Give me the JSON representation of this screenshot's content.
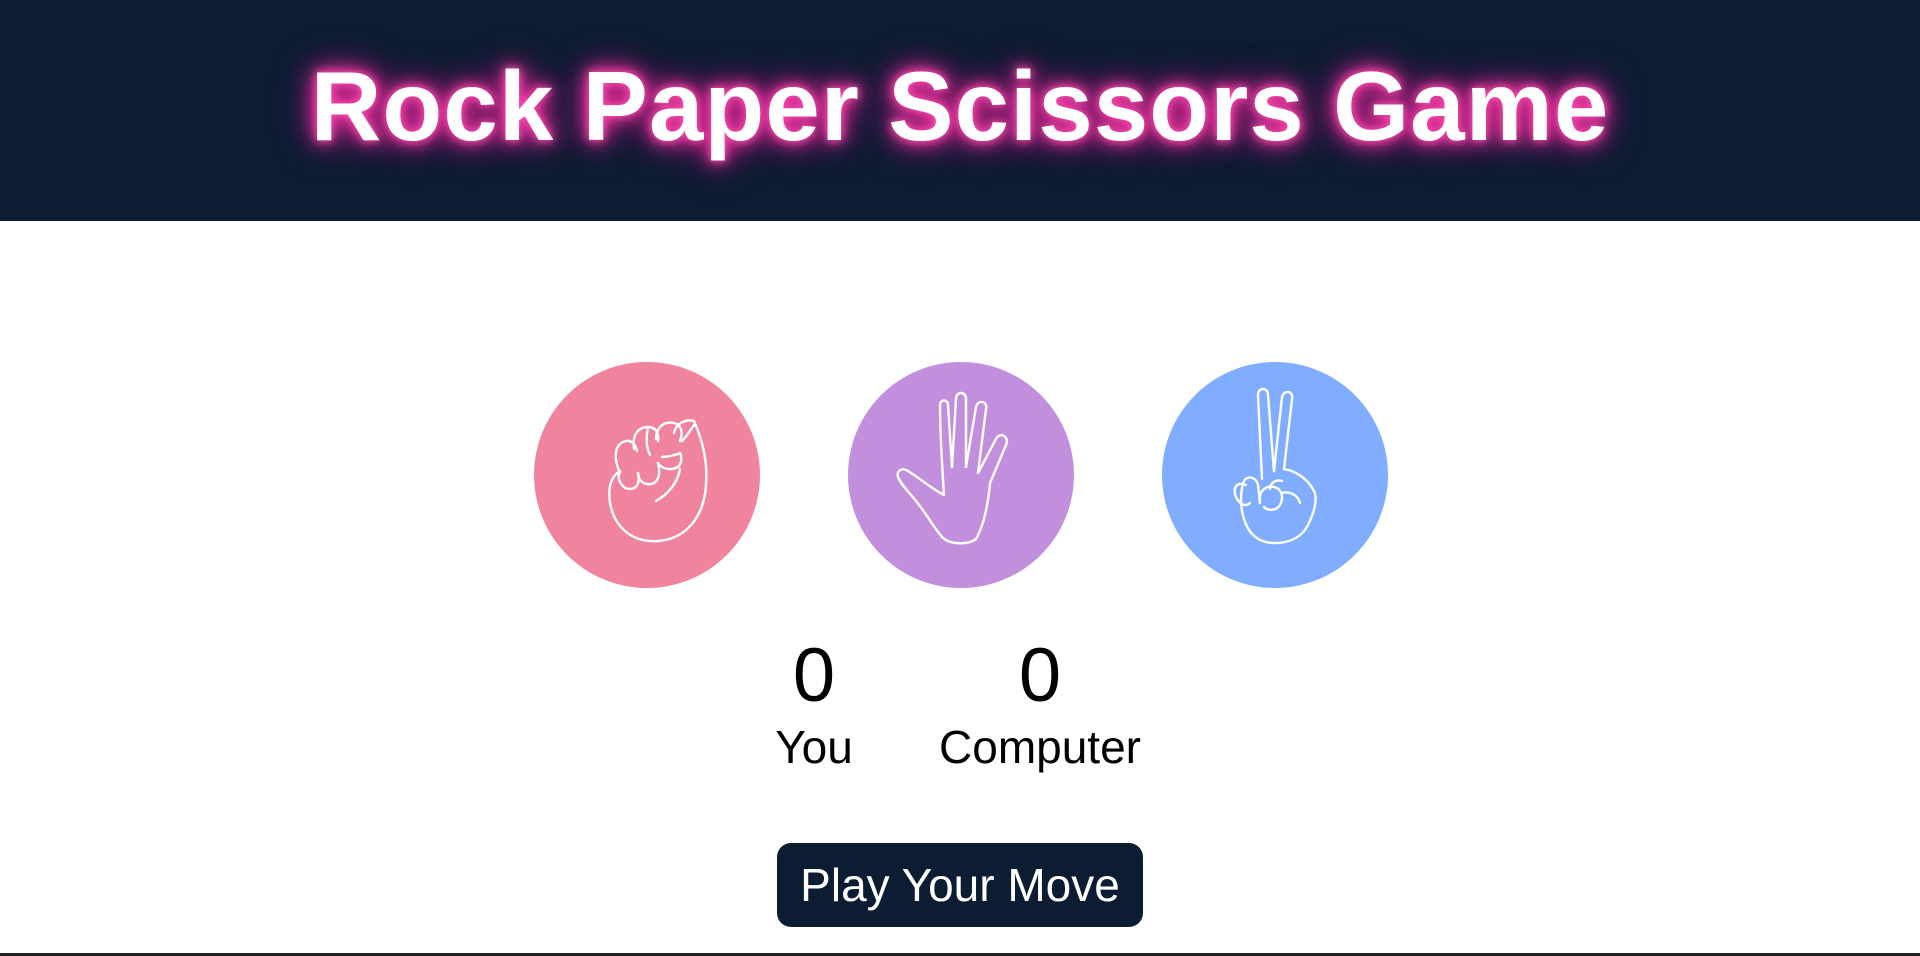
{
  "header": {
    "title": "Rock Paper Scissors Game"
  },
  "choices": [
    {
      "name": "rock",
      "icon": "fist-hand-icon",
      "color": "#f0849f"
    },
    {
      "name": "paper",
      "icon": "open-hand-icon",
      "color": "#c28fdc"
    },
    {
      "name": "scissors",
      "icon": "peace-sign-hand-icon",
      "color": "#80adff"
    }
  ],
  "scoreboard": {
    "user": {
      "score": "0",
      "label": "You"
    },
    "computer": {
      "score": "0",
      "label": "Computer"
    }
  },
  "play_button": {
    "label": "Play Your Move"
  },
  "colors": {
    "header_bg": "#0c1c33",
    "title_glow": "#ff3ea8",
    "button_bg": "#0c1c33"
  }
}
